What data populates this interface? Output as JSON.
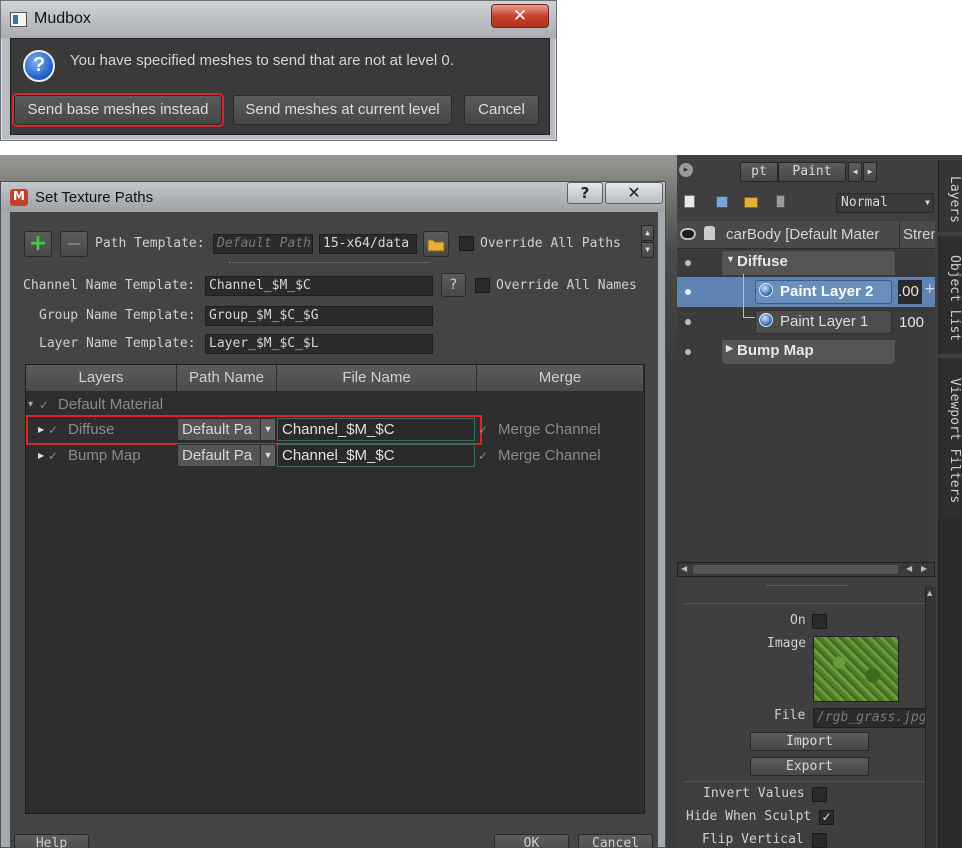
{
  "mudbox": {
    "title": "Mudbox",
    "close": "✕",
    "question": "?",
    "message": "You have specified meshes to send that are not at level 0.",
    "buttons": [
      "Send base meshes instead",
      "Send meshes at current level",
      "Cancel"
    ]
  },
  "texture": {
    "title": "Set Texture Paths",
    "help_glyph": "?",
    "close_glyph": "✕",
    "add_glyph": "+",
    "remove_glyph": "—",
    "path_template_label": "Path Template:",
    "path_template_placeholder": "Default Path",
    "path_template_value": "15-x64/data",
    "override_paths_label": "Override All Paths",
    "channel_label": "Channel Name Template:",
    "channel_value": "Channel_$M_$C",
    "override_names_label": "Override All Names",
    "group_label": "Group Name Template:",
    "group_value": "Group_$M_$C_$G",
    "layer_label": "Layer Name Template:",
    "layer_value": "Layer_$M_$C_$L",
    "columns": [
      "Layers",
      "Path Name",
      "File Name",
      "Merge"
    ],
    "material": "Default Material",
    "rows": [
      {
        "name": "Diffuse",
        "path": "Default Pa",
        "file": "Channel_$M_$C",
        "merge": "Merge Channel"
      },
      {
        "name": "Bump Map",
        "path": "Default Pa",
        "file": "Channel_$M_$C",
        "merge": "Merge Channel"
      }
    ],
    "bottom_buttons": [
      "Help",
      "OK",
      "Cancel"
    ]
  },
  "layers_panel": {
    "tab_partial": "pt",
    "tab_paint": "Paint",
    "blend_mode": "Normal",
    "header_name": "carBody [Default Mater",
    "header_strength": "Stren",
    "groups": [
      {
        "label": "Diffuse"
      },
      {
        "label": "Bump Map"
      }
    ],
    "layers": [
      {
        "name": "Paint Layer 2",
        "value": ".00"
      },
      {
        "name": "Paint Layer 1",
        "value": "100"
      }
    ],
    "side_tabs": [
      "Layers",
      "Object List",
      "Viewport Filters"
    ],
    "props": {
      "on_label": "On",
      "image_label": "Image",
      "file_label": "File",
      "file_value": "/rgb_grass.jpg",
      "import_label": "Import",
      "export_label": "Export",
      "invert_label": "Invert Values",
      "hide_label": "Hide When Sculpt",
      "flip_label": "Flip Vertical"
    }
  },
  "colors": {
    "highlight": "#d9262a",
    "selection": "#5f84b4",
    "panel_bg": "#3f3f3f"
  }
}
